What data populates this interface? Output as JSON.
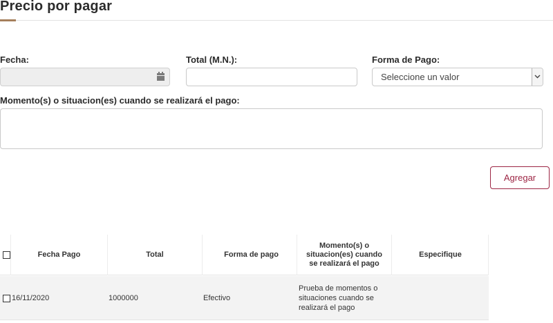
{
  "section": {
    "title": "Precio por pagar"
  },
  "colors": {
    "accent": "#a57f5c",
    "button": "#9c2443"
  },
  "form": {
    "fecha": {
      "label": "Fecha:",
      "value": "",
      "icon": "calendar-icon"
    },
    "total": {
      "label": "Total (M.N.):",
      "value": ""
    },
    "forma_pago": {
      "label": "Forma de Pago:",
      "selected": "Seleccione un valor",
      "icon": "chevron-down-icon"
    },
    "momentos": {
      "label": "Momento(s) o situacion(es) cuando se realizará el pago:",
      "value": ""
    }
  },
  "actions": {
    "add_label": "Agregar"
  },
  "table": {
    "headers": {
      "fecha_pago": "Fecha Pago",
      "total": "Total",
      "forma_pago": "Forma de pago",
      "momentos": "Momento(s) o situacion(es) cuando se realizará el pago",
      "especifique": "Especifique"
    },
    "rows": [
      {
        "fecha_pago": "16/11/2020",
        "total": "1000000",
        "forma_pago": "Efectivo",
        "momentos": "Prueba de momentos o situaciones cuando se realizará el pago",
        "especifique": ""
      }
    ]
  }
}
